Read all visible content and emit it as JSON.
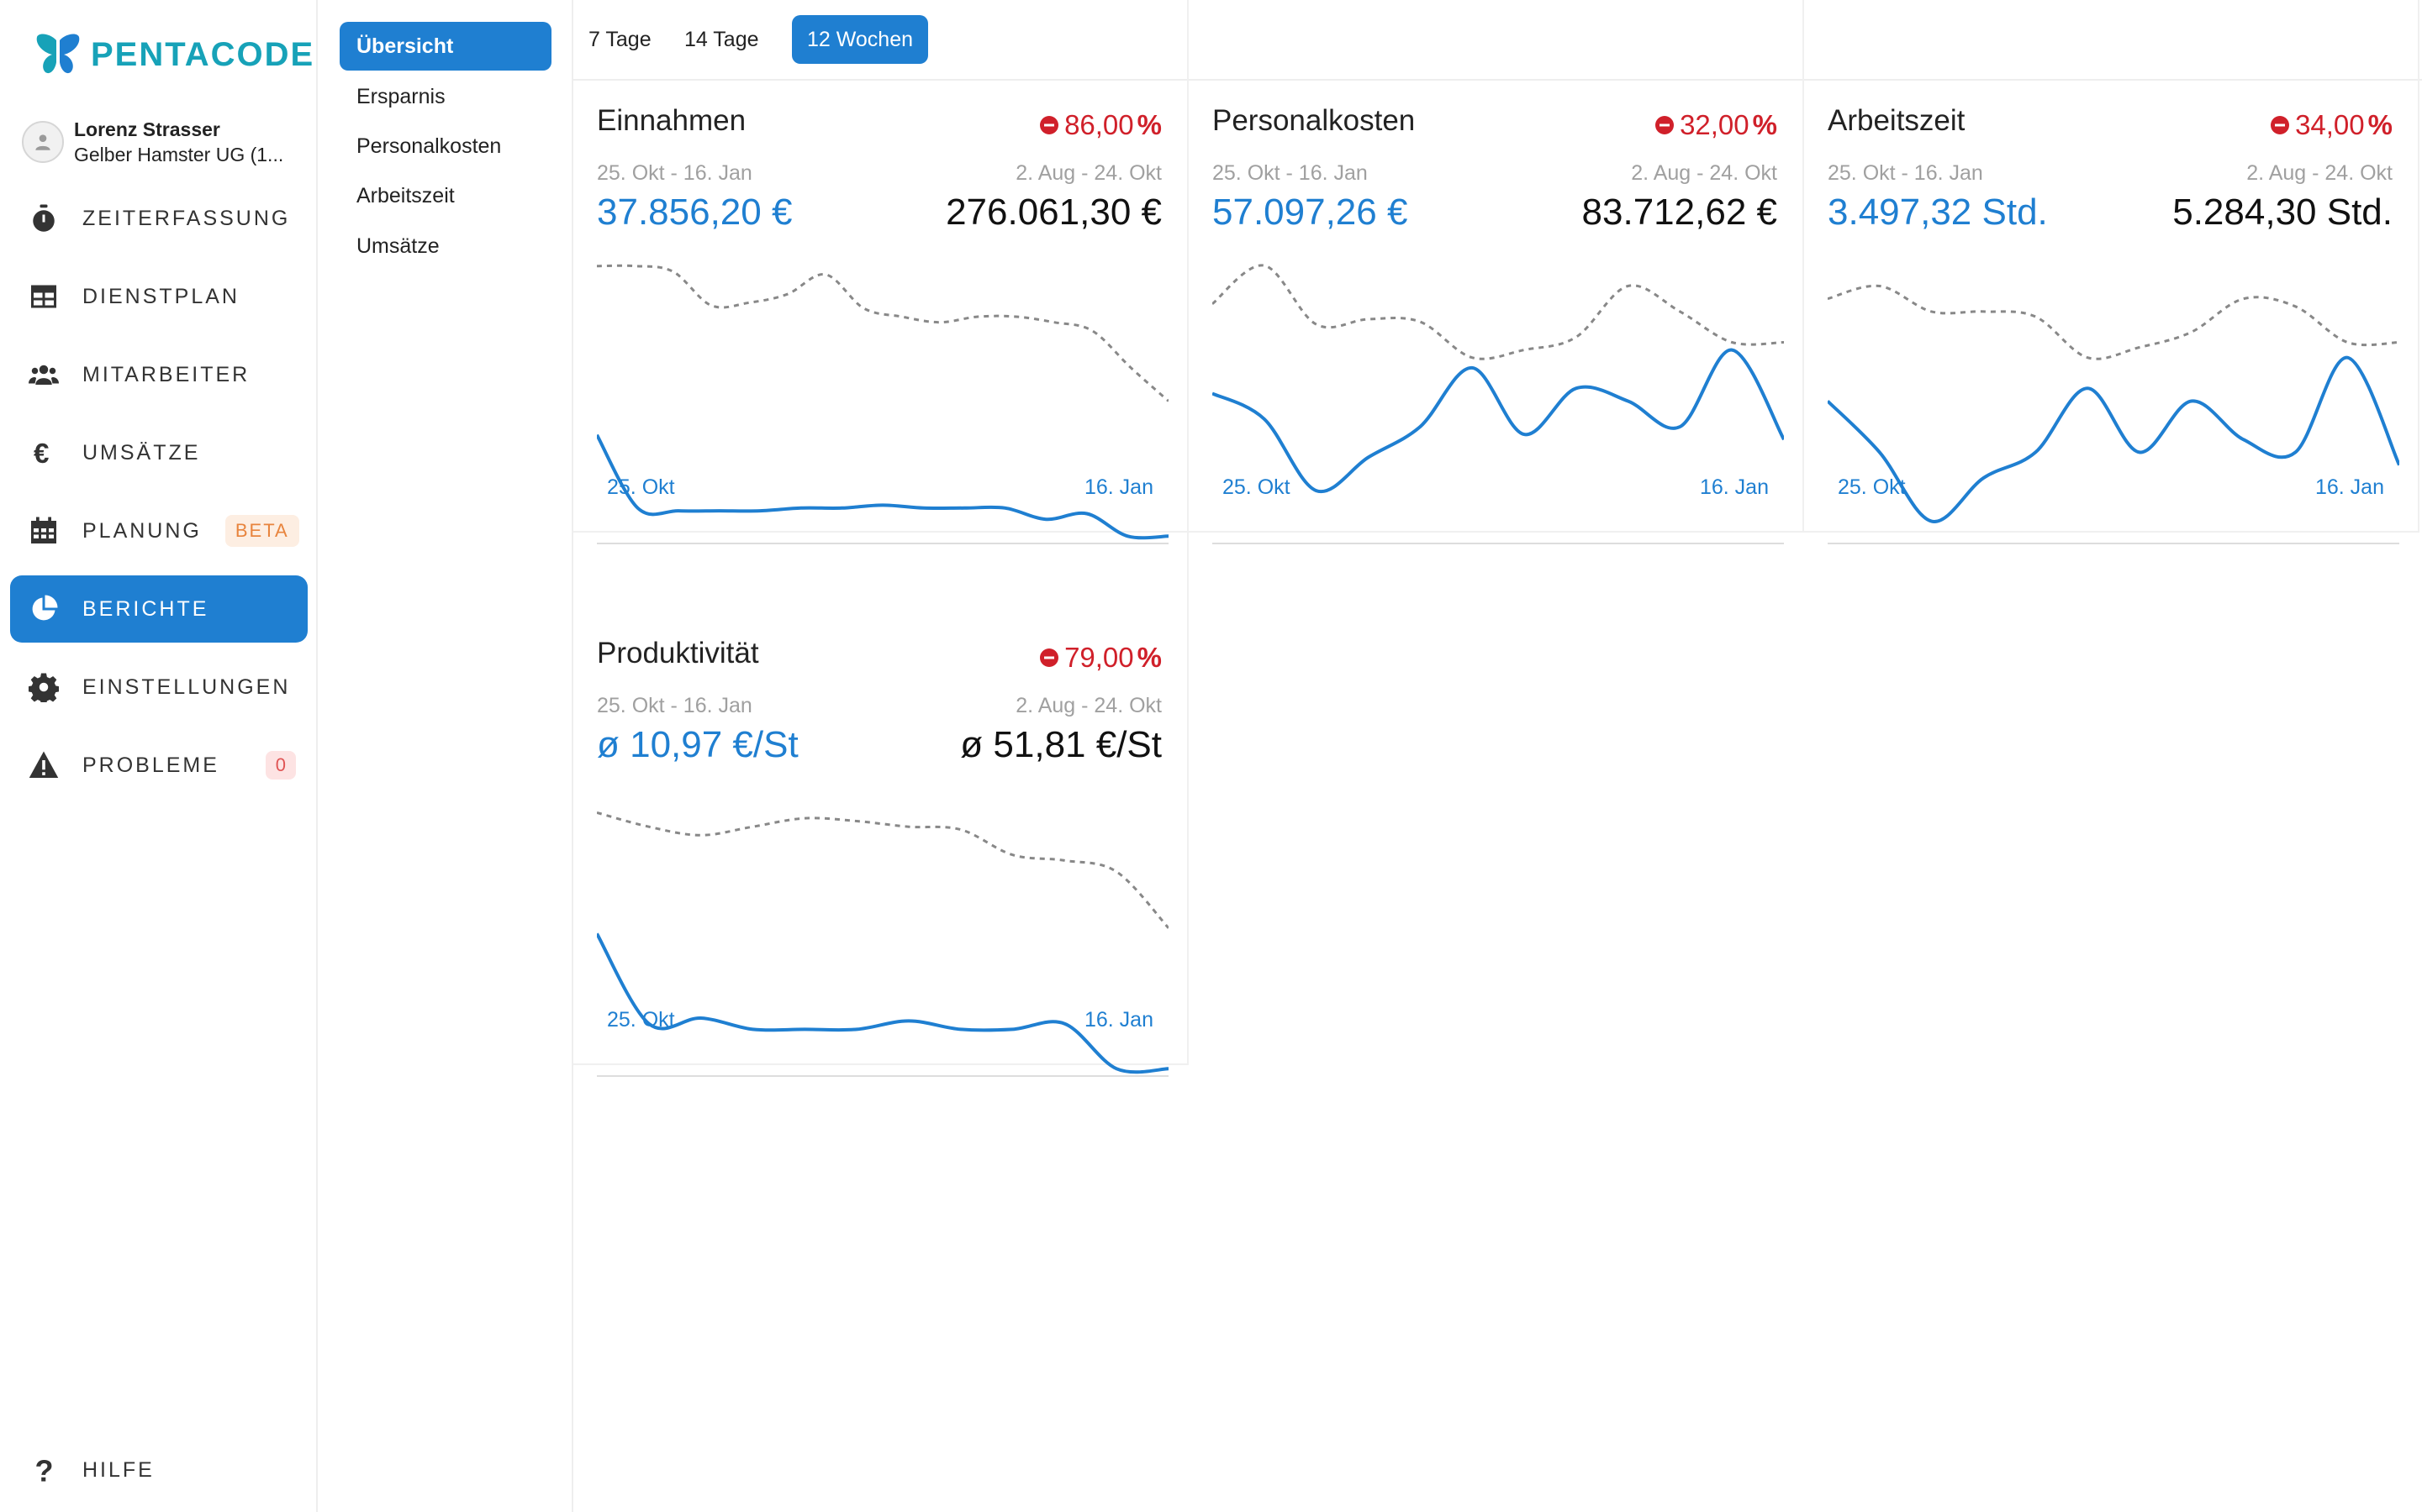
{
  "brand": {
    "name": "PENTACODE",
    "color": "#17a2b8"
  },
  "profile": {
    "name": "Lorenz Strasser",
    "company": "Gelber Hamster UG (1..."
  },
  "nav": {
    "items": [
      {
        "label": "Zeiterfassung",
        "icon": "stopwatch-icon"
      },
      {
        "label": "Dienstplan",
        "icon": "table-icon"
      },
      {
        "label": "Mitarbeiter",
        "icon": "users-icon"
      },
      {
        "label": "Umsätze",
        "icon": "euro-icon"
      },
      {
        "label": "Planung",
        "icon": "calendar-icon",
        "badge": "BETA"
      },
      {
        "label": "Berichte",
        "icon": "pie-chart-icon",
        "active": true
      },
      {
        "label": "Einstellungen",
        "icon": "gear-icon"
      },
      {
        "label": "Probleme",
        "icon": "warning-icon",
        "badge": "0"
      }
    ],
    "help": {
      "label": "Hilfe",
      "icon": "question-icon"
    }
  },
  "subnav": {
    "items": [
      "Übersicht",
      "Ersparnis",
      "Personalkosten",
      "Arbeitszeit",
      "Umsätze"
    ],
    "active": "Übersicht"
  },
  "range_tabs": {
    "items": [
      "7 Tage",
      "14 Tage",
      "12 Wochen"
    ],
    "active": "12 Wochen"
  },
  "colors": {
    "accent": "#1f7fd1",
    "negative": "#d0202a",
    "previous_line": "#888888"
  },
  "cards": [
    {
      "title": "Einnahmen",
      "change": "86,00",
      "range_current": "25. Okt - 16. Jan",
      "range_previous": "2. Aug - 24. Okt",
      "value_current": "37.856,20 €",
      "value_previous": "276.061,30 €",
      "x_start": "25. Okt",
      "x_end": "16. Jan"
    },
    {
      "title": "Personalkosten",
      "change": "32,00",
      "range_current": "25. Okt - 16. Jan",
      "range_previous": "2. Aug - 24. Okt",
      "value_current": "57.097,26 €",
      "value_previous": "83.712,62 €",
      "x_start": "25. Okt",
      "x_end": "16. Jan"
    },
    {
      "title": "Arbeitszeit",
      "change": "34,00",
      "range_current": "25. Okt - 16. Jan",
      "range_previous": "2. Aug - 24. Okt",
      "value_current": "3.497,32 Std.",
      "value_previous": "5.284,30 Std.",
      "x_start": "25. Okt",
      "x_end": "16. Jan"
    },
    {
      "title": "Produktivität",
      "change": "79,00",
      "range_current": "25. Okt - 16. Jan",
      "range_previous": "2. Aug - 24. Okt",
      "value_current": "ø 10,97 €/St",
      "value_previous": "ø 51,81 €/St",
      "x_start": "25. Okt",
      "x_end": "16. Jan"
    }
  ],
  "chart_data": [
    {
      "type": "line",
      "x": [
        "25. Okt",
        "16. Jan"
      ],
      "series": [
        {
          "values": [
            0.38,
            0.12,
            0.11,
            0.11,
            0.11,
            0.12,
            0.12,
            0.13,
            0.12,
            0.12,
            0.12,
            0.08,
            0.1,
            0.02,
            0.02
          ]
        },
        {
          "values": [
            0.98,
            0.98,
            0.96,
            0.84,
            0.85,
            0.88,
            0.95,
            0.83,
            0.8,
            0.78,
            0.8,
            0.8,
            0.78,
            0.75,
            0.62,
            0.5
          ]
        }
      ],
      "ylim": [
        0,
        1
      ]
    },
    {
      "type": "line",
      "x": [
        "25. Okt",
        "16. Jan"
      ],
      "series": [
        {
          "values": [
            0.58,
            0.48,
            0.2,
            0.33,
            0.45,
            0.68,
            0.42,
            0.6,
            0.55,
            0.45,
            0.75,
            0.4
          ]
        },
        {
          "values": [
            0.93,
            1.08,
            0.85,
            0.87,
            0.86,
            0.72,
            0.75,
            0.8,
            1.0,
            0.9,
            0.78,
            0.78
          ]
        }
      ],
      "ylim": [
        0,
        1.1
      ]
    },
    {
      "type": "line",
      "x": [
        "25. Okt",
        "16. Jan"
      ],
      "series": [
        {
          "values": [
            0.55,
            0.35,
            0.08,
            0.25,
            0.35,
            0.6,
            0.35,
            0.55,
            0.4,
            0.35,
            0.72,
            0.3
          ]
        },
        {
          "values": [
            0.95,
            1.0,
            0.9,
            0.9,
            0.88,
            0.72,
            0.76,
            0.82,
            0.95,
            0.92,
            0.78,
            0.78
          ]
        }
      ],
      "ylim": [
        0,
        1.1
      ]
    },
    {
      "type": "line",
      "x": [
        "25. Okt",
        "16. Jan"
      ],
      "series": [
        {
          "values": [
            0.5,
            0.18,
            0.2,
            0.16,
            0.16,
            0.16,
            0.19,
            0.16,
            0.16,
            0.18,
            0.02,
            0.02
          ]
        },
        {
          "values": [
            0.93,
            0.88,
            0.85,
            0.88,
            0.91,
            0.9,
            0.88,
            0.87,
            0.78,
            0.76,
            0.72,
            0.52
          ]
        }
      ],
      "ylim": [
        0,
        1
      ]
    }
  ]
}
